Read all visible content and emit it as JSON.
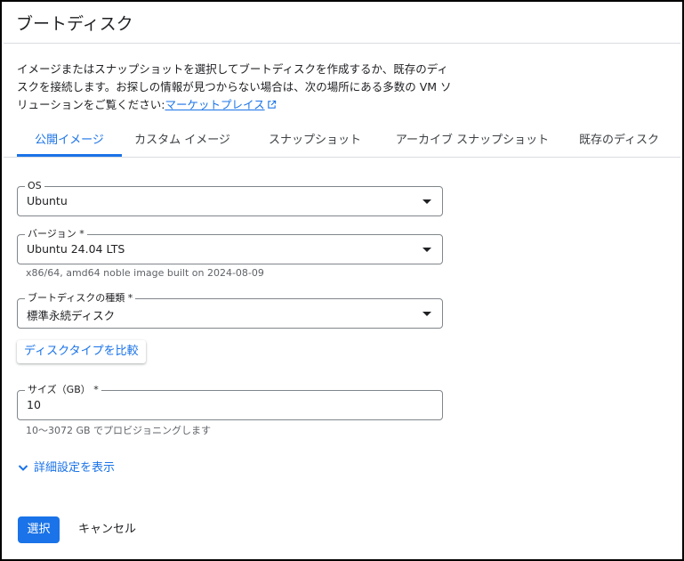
{
  "dialog": {
    "title": "ブートディスク",
    "description_line1": "イメージまたはスナップショットを選択してブートディスクを作成するか、既存のディ",
    "description_line2": "スクを接続します。お探しの情報が見つからない場合は、次の場所にある多数の VM ソ",
    "description_line3": "リューションをご覧ください:",
    "marketplace_link": "マーケットプレイス",
    "marketplace_icon": "external-link-icon"
  },
  "tabs": [
    {
      "label": "公開イメージ",
      "active": true
    },
    {
      "label": "カスタム イメージ",
      "active": false
    },
    {
      "label": "スナップショット",
      "active": false
    },
    {
      "label": "アーカイブ スナップショット",
      "active": false
    },
    {
      "label": "既存のディスク",
      "active": false
    }
  ],
  "form": {
    "os": {
      "label": "OS",
      "value": "Ubuntu"
    },
    "version": {
      "label": "バージョン *",
      "value": "Ubuntu 24.04 LTS",
      "hint": "x86/64, amd64 noble image built on 2024-08-09"
    },
    "disk_type": {
      "label": "ブートディスクの種類 *",
      "value": "標準永続ディスク"
    },
    "compare_button": "ディスクタイプを比較",
    "size": {
      "label": "サイズ（GB） *",
      "value": "10",
      "hint": "10～3072 GB でプロビジョニングします"
    },
    "advanced_toggle": "詳細設定を表示"
  },
  "actions": {
    "select_label": "選択",
    "cancel_label": "キャンセル"
  },
  "colors": {
    "accent": "#1a73e8",
    "border": "#80868b",
    "divider": "#dadce0"
  }
}
